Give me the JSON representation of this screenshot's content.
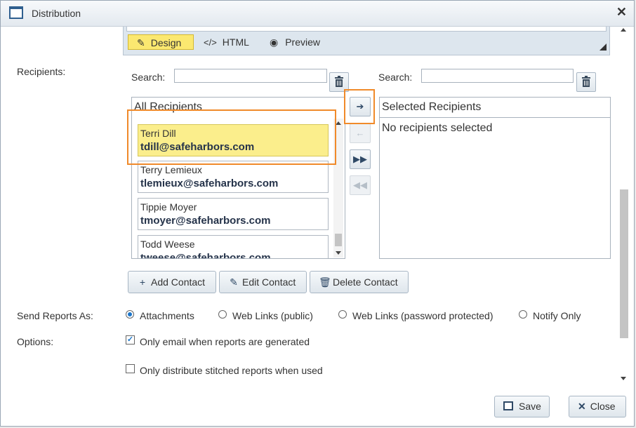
{
  "window": {
    "title": "Distribution",
    "close_icon": "✕"
  },
  "editor": {
    "tabs": [
      {
        "label": "Design"
      },
      {
        "label": "HTML"
      },
      {
        "label": "Preview"
      }
    ]
  },
  "recipients": {
    "label": "Recipients:",
    "search_label": "Search:",
    "all_header": "All Recipients",
    "selected_header": "Selected Recipients",
    "selected_empty": "No recipients selected",
    "list": [
      {
        "name": "Terri Dill",
        "email": "tdill@safeharbors.com",
        "selected": true
      },
      {
        "name": "Terry Lemieux",
        "email": "tlemieux@safeharbors.com",
        "selected": false
      },
      {
        "name": "Tippie Moyer",
        "email": "tmoyer@safeharbors.com",
        "selected": false
      },
      {
        "name": "Todd Weese",
        "email": "tweese@safeharbors.com",
        "selected": false
      }
    ]
  },
  "contact_actions": {
    "add": "Add Contact",
    "edit": "Edit Contact",
    "delete": "Delete Contact"
  },
  "send_as": {
    "label": "Send Reports As:",
    "options": [
      "Attachments",
      "Web Links (public)",
      "Web Links (password protected)",
      "Notify Only"
    ],
    "selected": "Attachments"
  },
  "options": {
    "label": "Options:",
    "only_email": {
      "label": "Only email when reports are generated",
      "checked": true
    },
    "stitched": {
      "label": "Only distribute stitched reports when used",
      "checked": false
    }
  },
  "footer": {
    "save": "Save",
    "close": "Close"
  },
  "colors": {
    "highlight": "#f08a2a",
    "selected_row": "#fbee8c",
    "accent": "#1b75c9"
  }
}
